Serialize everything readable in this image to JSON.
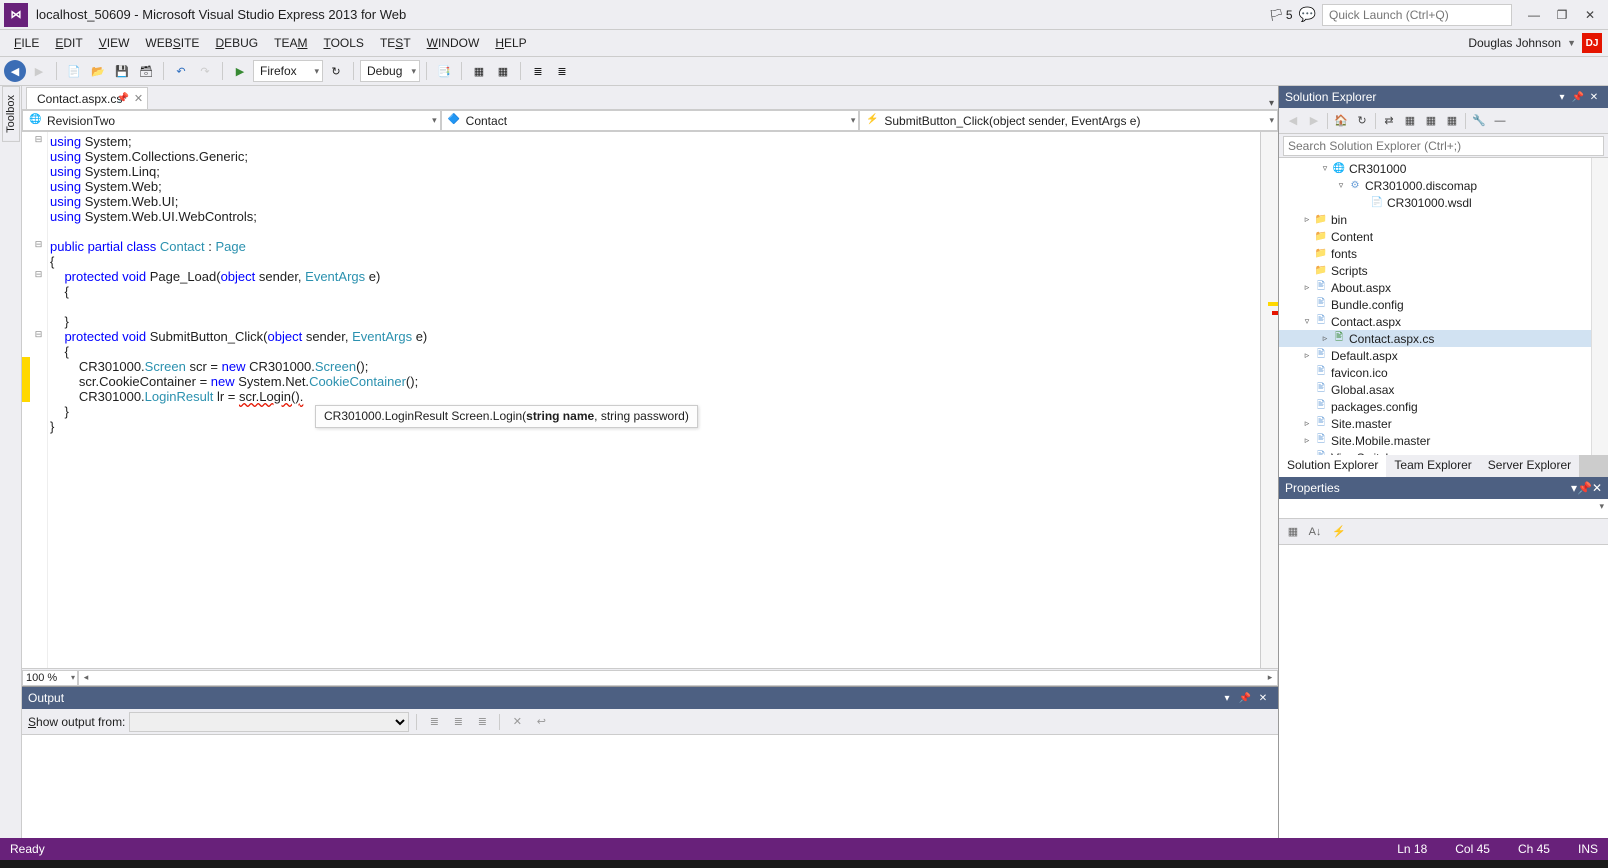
{
  "title": "localhost_50609 - Microsoft Visual Studio Express 2013 for Web",
  "notify_count": "5",
  "quick_launch_placeholder": "Quick Launch (Ctrl+Q)",
  "menu": {
    "file": "FILE",
    "edit": "EDIT",
    "view": "VIEW",
    "website": "WEBSITE",
    "debug": "DEBUG",
    "team": "TEAM",
    "tools": "TOOLS",
    "test": "TEST",
    "window": "WINDOW",
    "help": "HELP"
  },
  "user_name": "Douglas Johnson",
  "user_initials": "DJ",
  "toolbar": {
    "browser": "Firefox",
    "config": "Debug"
  },
  "toolbox_tab": "Toolbox",
  "file_tab": "Contact.aspx.cs*",
  "nav": {
    "left": "RevisionTwo",
    "mid": "Contact",
    "right": "SubmitButton_Click(object sender, EventArgs e)"
  },
  "intellisense_a": "CR301000.LoginResult Screen.Login(",
  "intellisense_b": "string name",
  "intellisense_c": ", string password)",
  "zoom": "100 %",
  "output": {
    "title": "Output",
    "label": "Show output from:"
  },
  "se": {
    "title": "Solution Explorer",
    "search_placeholder": "Search Solution Explorer (Ctrl+;)",
    "items": [
      {
        "pad": 40,
        "exp": "▿",
        "ico": "🌐",
        "cls": "world",
        "label": "CR301000"
      },
      {
        "pad": 56,
        "exp": "▿",
        "ico": "⚙",
        "cls": "file",
        "label": "CR301000.discomap"
      },
      {
        "pad": 78,
        "exp": "",
        "ico": "📄",
        "cls": "file",
        "label": "CR301000.wsdl"
      },
      {
        "pad": 22,
        "exp": "▹",
        "ico": "📁",
        "cls": "folder",
        "label": "bin"
      },
      {
        "pad": 22,
        "exp": "",
        "ico": "📁",
        "cls": "folder",
        "label": "Content"
      },
      {
        "pad": 22,
        "exp": "",
        "ico": "📁",
        "cls": "folder",
        "label": "fonts"
      },
      {
        "pad": 22,
        "exp": "",
        "ico": "📁",
        "cls": "folder",
        "label": "Scripts"
      },
      {
        "pad": 22,
        "exp": "▹",
        "ico": "🖹",
        "cls": "file",
        "label": "About.aspx"
      },
      {
        "pad": 22,
        "exp": "",
        "ico": "🖹",
        "cls": "file",
        "label": "Bundle.config"
      },
      {
        "pad": 22,
        "exp": "▿",
        "ico": "🖹",
        "cls": "file",
        "label": "Contact.aspx"
      },
      {
        "pad": 40,
        "exp": "▹",
        "ico": "🖹",
        "cls": "cs",
        "label": "Contact.aspx.cs",
        "selected": true
      },
      {
        "pad": 22,
        "exp": "▹",
        "ico": "🖹",
        "cls": "file",
        "label": "Default.aspx"
      },
      {
        "pad": 22,
        "exp": "",
        "ico": "🖹",
        "cls": "file",
        "label": "favicon.ico"
      },
      {
        "pad": 22,
        "exp": "",
        "ico": "🖹",
        "cls": "file",
        "label": "Global.asax"
      },
      {
        "pad": 22,
        "exp": "",
        "ico": "🖹",
        "cls": "file",
        "label": "packages.config"
      },
      {
        "pad": 22,
        "exp": "▹",
        "ico": "🖹",
        "cls": "file",
        "label": "Site.master"
      },
      {
        "pad": 22,
        "exp": "▹",
        "ico": "🖹",
        "cls": "file",
        "label": "Site.Mobile.master"
      },
      {
        "pad": 22,
        "exp": "▹",
        "ico": "🖹",
        "cls": "file",
        "label": "ViewSwitcher.ascx"
      }
    ],
    "tabs": {
      "se": "Solution Explorer",
      "te": "Team Explorer",
      "srv": "Server Explorer"
    }
  },
  "properties": {
    "title": "Properties"
  },
  "status": {
    "ready": "Ready",
    "ln": "Ln 18",
    "col": "Col 45",
    "ch": "Ch 45",
    "ins": "INS"
  }
}
